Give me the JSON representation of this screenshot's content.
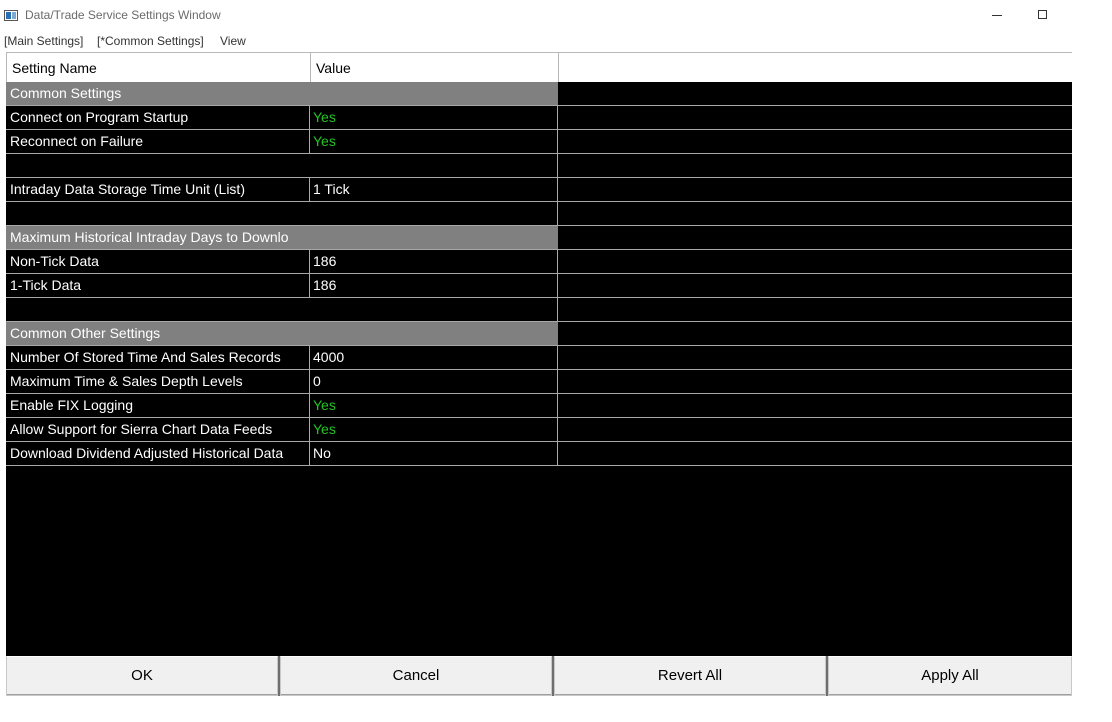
{
  "window": {
    "title": "Data/Trade Service Settings Window",
    "icon": "app-window-icon"
  },
  "menu": [
    {
      "label": "[Main Settings]"
    },
    {
      "label": "[*Common Settings]"
    },
    {
      "label": "View"
    }
  ],
  "table": {
    "columns": [
      "Setting Name",
      "Value",
      ""
    ],
    "rows": [
      {
        "type": "section",
        "name": "Common Settings",
        "value": ""
      },
      {
        "type": "setting",
        "name": "Connect on Program Startup",
        "value": "Yes"
      },
      {
        "type": "setting",
        "name": "Reconnect on Failure",
        "value": "Yes"
      },
      {
        "type": "blank",
        "name": "",
        "value": ""
      },
      {
        "type": "setting",
        "name": "Intraday Data Storage Time Unit (List)",
        "value": "1 Tick"
      },
      {
        "type": "blank",
        "name": "",
        "value": ""
      },
      {
        "type": "section",
        "name": "Maximum Historical Intraday Days to Downlo",
        "value": ""
      },
      {
        "type": "setting",
        "name": "Non-Tick Data",
        "value": "186"
      },
      {
        "type": "setting",
        "name": "1-Tick Data",
        "value": "186"
      },
      {
        "type": "blank",
        "name": "",
        "value": ""
      },
      {
        "type": "section",
        "name": "Common Other Settings",
        "value": ""
      },
      {
        "type": "setting",
        "name": "Number Of Stored Time And Sales Records",
        "value": "4000"
      },
      {
        "type": "setting",
        "name": "Maximum Time & Sales Depth Levels",
        "value": "0"
      },
      {
        "type": "setting",
        "name": "Enable FIX Logging",
        "value": "Yes"
      },
      {
        "type": "setting",
        "name": "Allow Support for Sierra Chart Data Feeds",
        "value": "Yes"
      },
      {
        "type": "setting",
        "name": "Download Dividend Adjusted Historical Data",
        "value": "No"
      }
    ]
  },
  "buttons": {
    "ok": "OK",
    "cancel": "Cancel",
    "revert_all": "Revert All",
    "apply_all": "Apply All"
  },
  "colors": {
    "panel_bg": "#000000",
    "section_bg": "#808080",
    "yes_text": "#22c322",
    "normal_text": "#ffffff"
  }
}
